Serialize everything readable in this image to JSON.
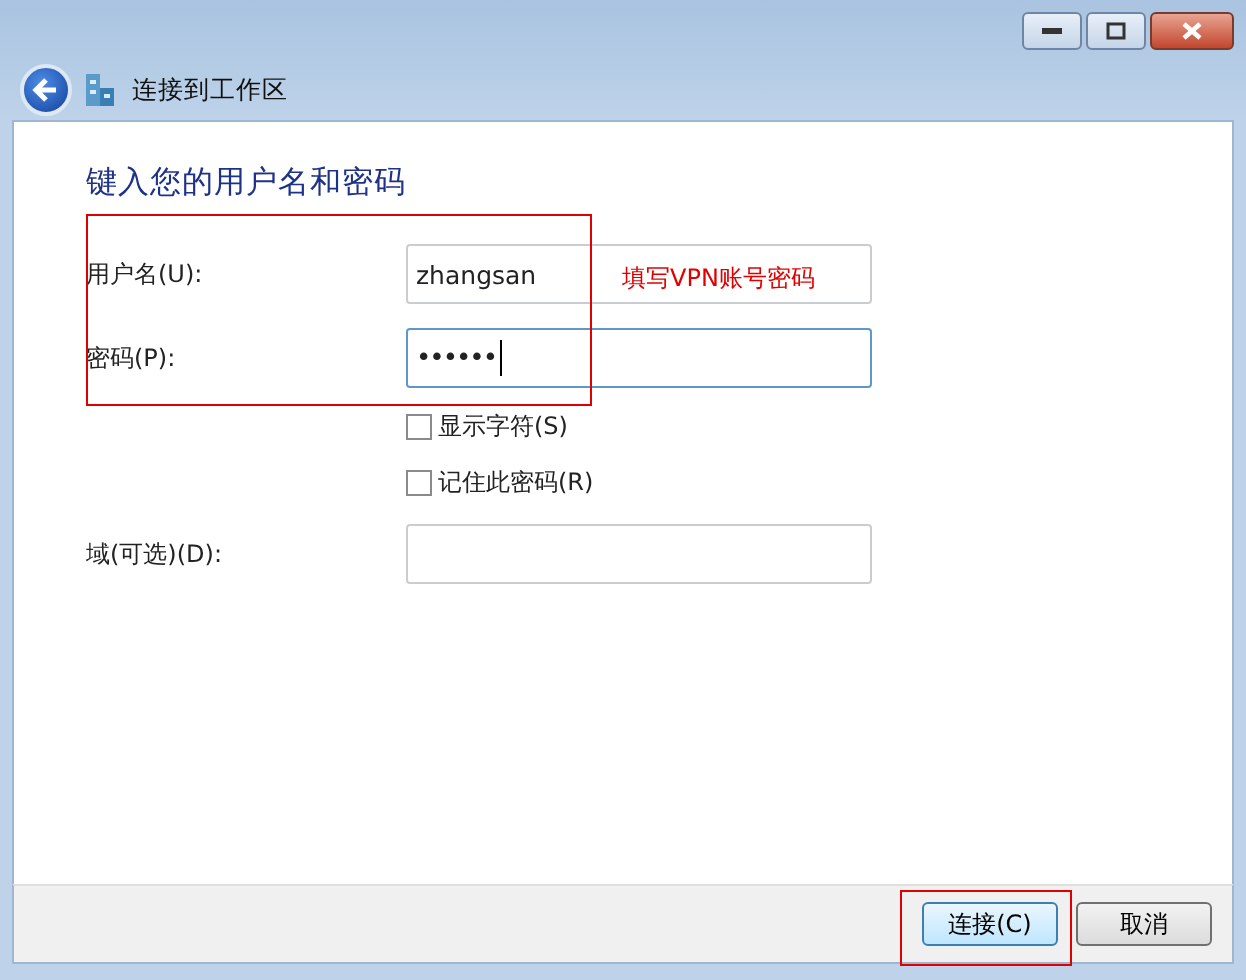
{
  "window": {
    "title": "连接到工作区"
  },
  "heading": "键入您的用户名和密码",
  "fields": [
    {
      "kind": "text",
      "label": "用户名(U):",
      "value": "zhangsan",
      "focused": false
    },
    {
      "kind": "password",
      "label": "密码(P):",
      "value": "••••••",
      "focused": true
    }
  ],
  "checkboxes": [
    {
      "label": "显示字符(S)",
      "checked": false
    },
    {
      "label": "记住此密码(R)",
      "checked": false
    }
  ],
  "domain": {
    "label": "域(可选)(D):"
  },
  "annotation": "填写VPN账号密码",
  "buttons": [
    {
      "label": "连接(C)",
      "default": true
    },
    {
      "label": "取消",
      "default": false
    }
  ]
}
